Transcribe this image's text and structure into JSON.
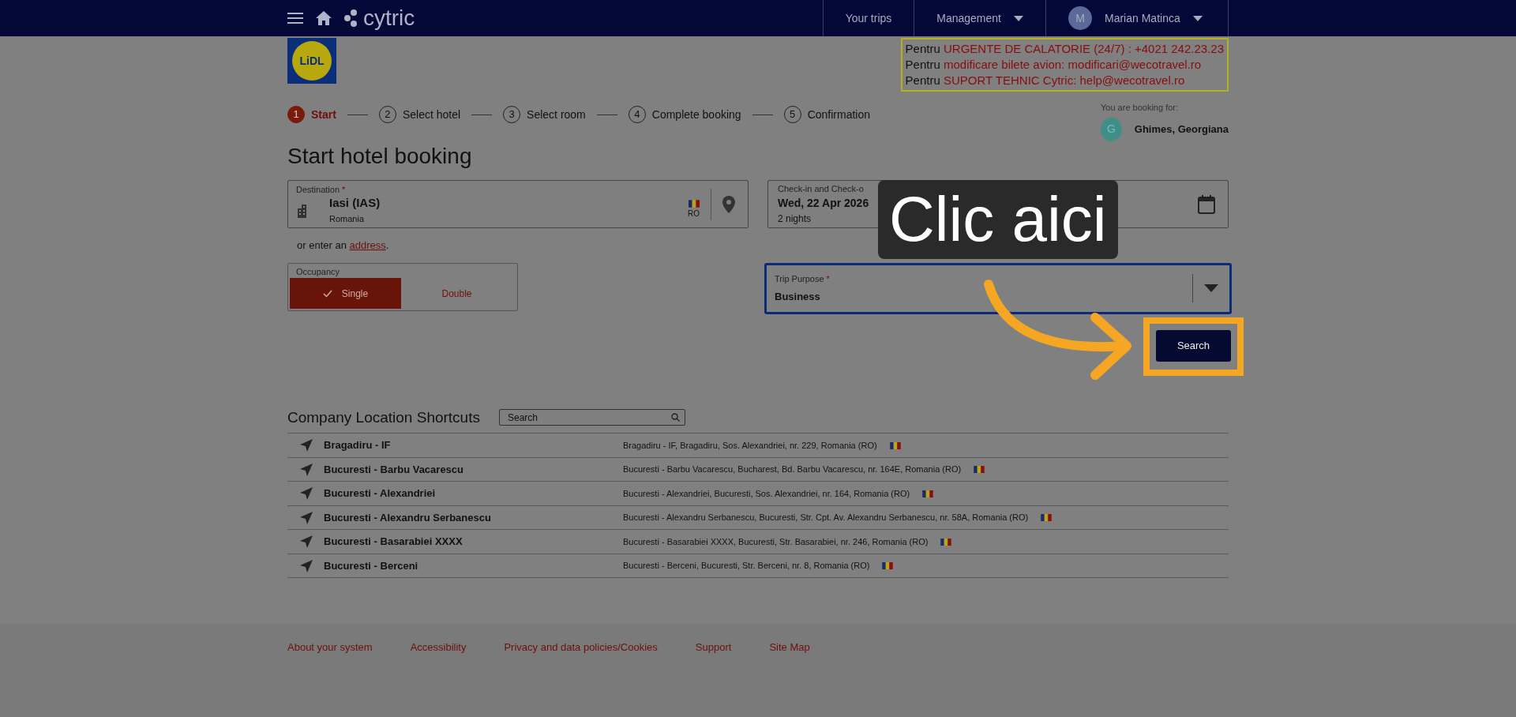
{
  "navbar": {
    "brand": "cytric",
    "links": [
      {
        "label": "Your trips",
        "dropdown": false
      },
      {
        "label": "Management",
        "dropdown": true
      }
    ],
    "user": {
      "initial": "M",
      "name": "Marian Matinca"
    }
  },
  "logo_text": "LiDL",
  "contact_lines": [
    {
      "prefix": "Pentru",
      "text": "URGENTE DE CALATORIE (24/7) : +4021 242.23.23"
    },
    {
      "prefix": "Pentru",
      "text": "modificare bilete avion:  modificari@wecotravel.ro"
    },
    {
      "prefix": "Pentru",
      "text": "SUPORT TEHNIC Cytric:  help@wecotravel.ro"
    }
  ],
  "steps": [
    {
      "number": "1",
      "label": "Start",
      "selected": true
    },
    {
      "number": "2",
      "label": "Select hotel",
      "selected": false
    },
    {
      "number": "3",
      "label": "Select room",
      "selected": false
    },
    {
      "number": "4",
      "label": "Complete booking",
      "selected": false
    },
    {
      "number": "5",
      "label": "Confirmation",
      "selected": false
    }
  ],
  "booking_for": {
    "label": "You are booking for:",
    "initial": "G",
    "name": "Ghimes, Georgiana"
  },
  "title": "Start hotel booking",
  "destination": {
    "label": "Destination",
    "required_mark": "*",
    "value": "Iasi (IAS)",
    "sub": "Romania",
    "country": "RO"
  },
  "dates": {
    "label": "Check-in and Check-o",
    "value": "Wed, 22 Apr 2026",
    "sub": "2 nights"
  },
  "address_hint": {
    "before": "or enter an",
    "link": "address",
    "after": "."
  },
  "occupancy": {
    "label": "Occupancy",
    "options": [
      {
        "label": "Single",
        "selected": true
      },
      {
        "label": "Double",
        "selected": false
      }
    ]
  },
  "trip_purpose": {
    "label": "Trip Purpose",
    "required_mark": "*",
    "value": "Business"
  },
  "search_button": "Search",
  "callout": {
    "text": "Clic aici"
  },
  "shortcuts": {
    "title": "Company Location Shortcuts",
    "search_placeholder": "Search",
    "rows": [
      {
        "name": "Bragadiru - IF",
        "address": "Bragadiru - IF, Bragadiru, Sos. Alexandriei, nr. 229, Romania (RO)"
      },
      {
        "name": "Bucuresti - Barbu Vacarescu",
        "address": "Bucuresti - Barbu Vacarescu, Bucharest, Bd. Barbu Vacarescu, nr. 164E, Romania (RO)"
      },
      {
        "name": "Bucuresti - Alexandriei",
        "address": "Bucuresti - Alexandriei, Bucuresti, Sos. Alexandriei, nr. 164, Romania (RO)"
      },
      {
        "name": "Bucuresti - Alexandru Serbanescu",
        "address": "Bucuresti - Alexandru Serbanescu, Bucuresti, Str. Cpt. Av. Alexandru Serbanescu, nr. 58A, Romania (RO)"
      },
      {
        "name": "Bucuresti - Basarabiei XXXX",
        "address": "Bucuresti - Basarabiei XXXX, Bucuresti, Str. Basarabiei, nr. 246, Romania (RO)"
      },
      {
        "name": "Bucuresti - Berceni",
        "address": "Bucuresti - Berceni, Bucuresti, Str. Berceni, nr. 8, Romania (RO)"
      }
    ]
  },
  "footer_links": [
    "About your system",
    "Accessibility",
    "Privacy and data policies/Cookies",
    "Support",
    "Site Map"
  ]
}
